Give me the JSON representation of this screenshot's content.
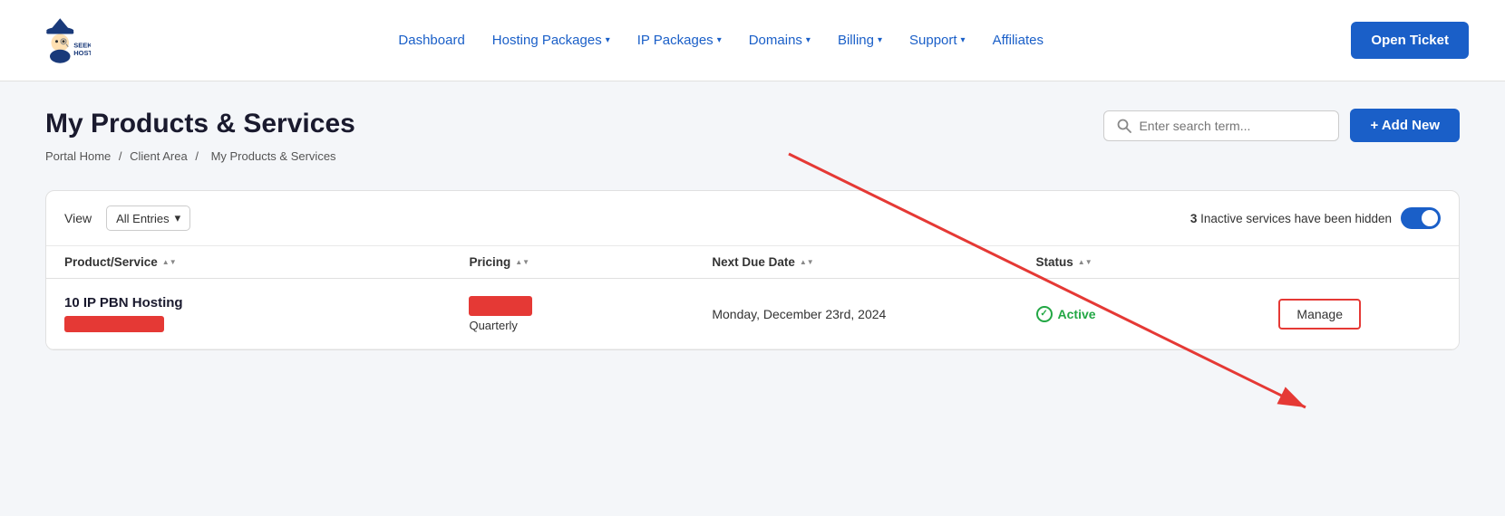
{
  "header": {
    "logo_text": "SeekaHost",
    "nav": {
      "dashboard": "Dashboard",
      "hosting_packages": "Hosting Packages",
      "ip_packages": "IP Packages",
      "domains": "Domains",
      "billing": "Billing",
      "support": "Support",
      "affiliates": "Affiliates"
    },
    "open_ticket": "Open Ticket"
  },
  "page": {
    "title": "My Products & Services",
    "breadcrumb": {
      "portal_home": "Portal Home",
      "client_area": "Client Area",
      "current": "My Products & Services",
      "sep": "/"
    },
    "search_placeholder": "Enter search term...",
    "add_new_label": "+ Add New"
  },
  "table": {
    "view_label": "View",
    "view_option": "All Entries",
    "hidden_text": "3 Inactive services have been hidden",
    "columns": {
      "product_service": "Product/Service",
      "pricing": "Pricing",
      "next_due_date": "Next Due Date",
      "status": "Status"
    },
    "rows": [
      {
        "service_name": "10 IP PBN Hosting",
        "pricing_period": "Quarterly",
        "next_due_date": "Monday, December 23rd, 2024",
        "status": "Active",
        "action": "Manage"
      }
    ]
  },
  "icons": {
    "search": "🔍",
    "dropdown_arrow": "▾",
    "sort": "⇅",
    "check": "✓",
    "toggle_on": "●"
  },
  "colors": {
    "primary": "#1a5fc8",
    "danger": "#e53935",
    "active_green": "#22a744",
    "text_dark": "#1a1a2e"
  }
}
